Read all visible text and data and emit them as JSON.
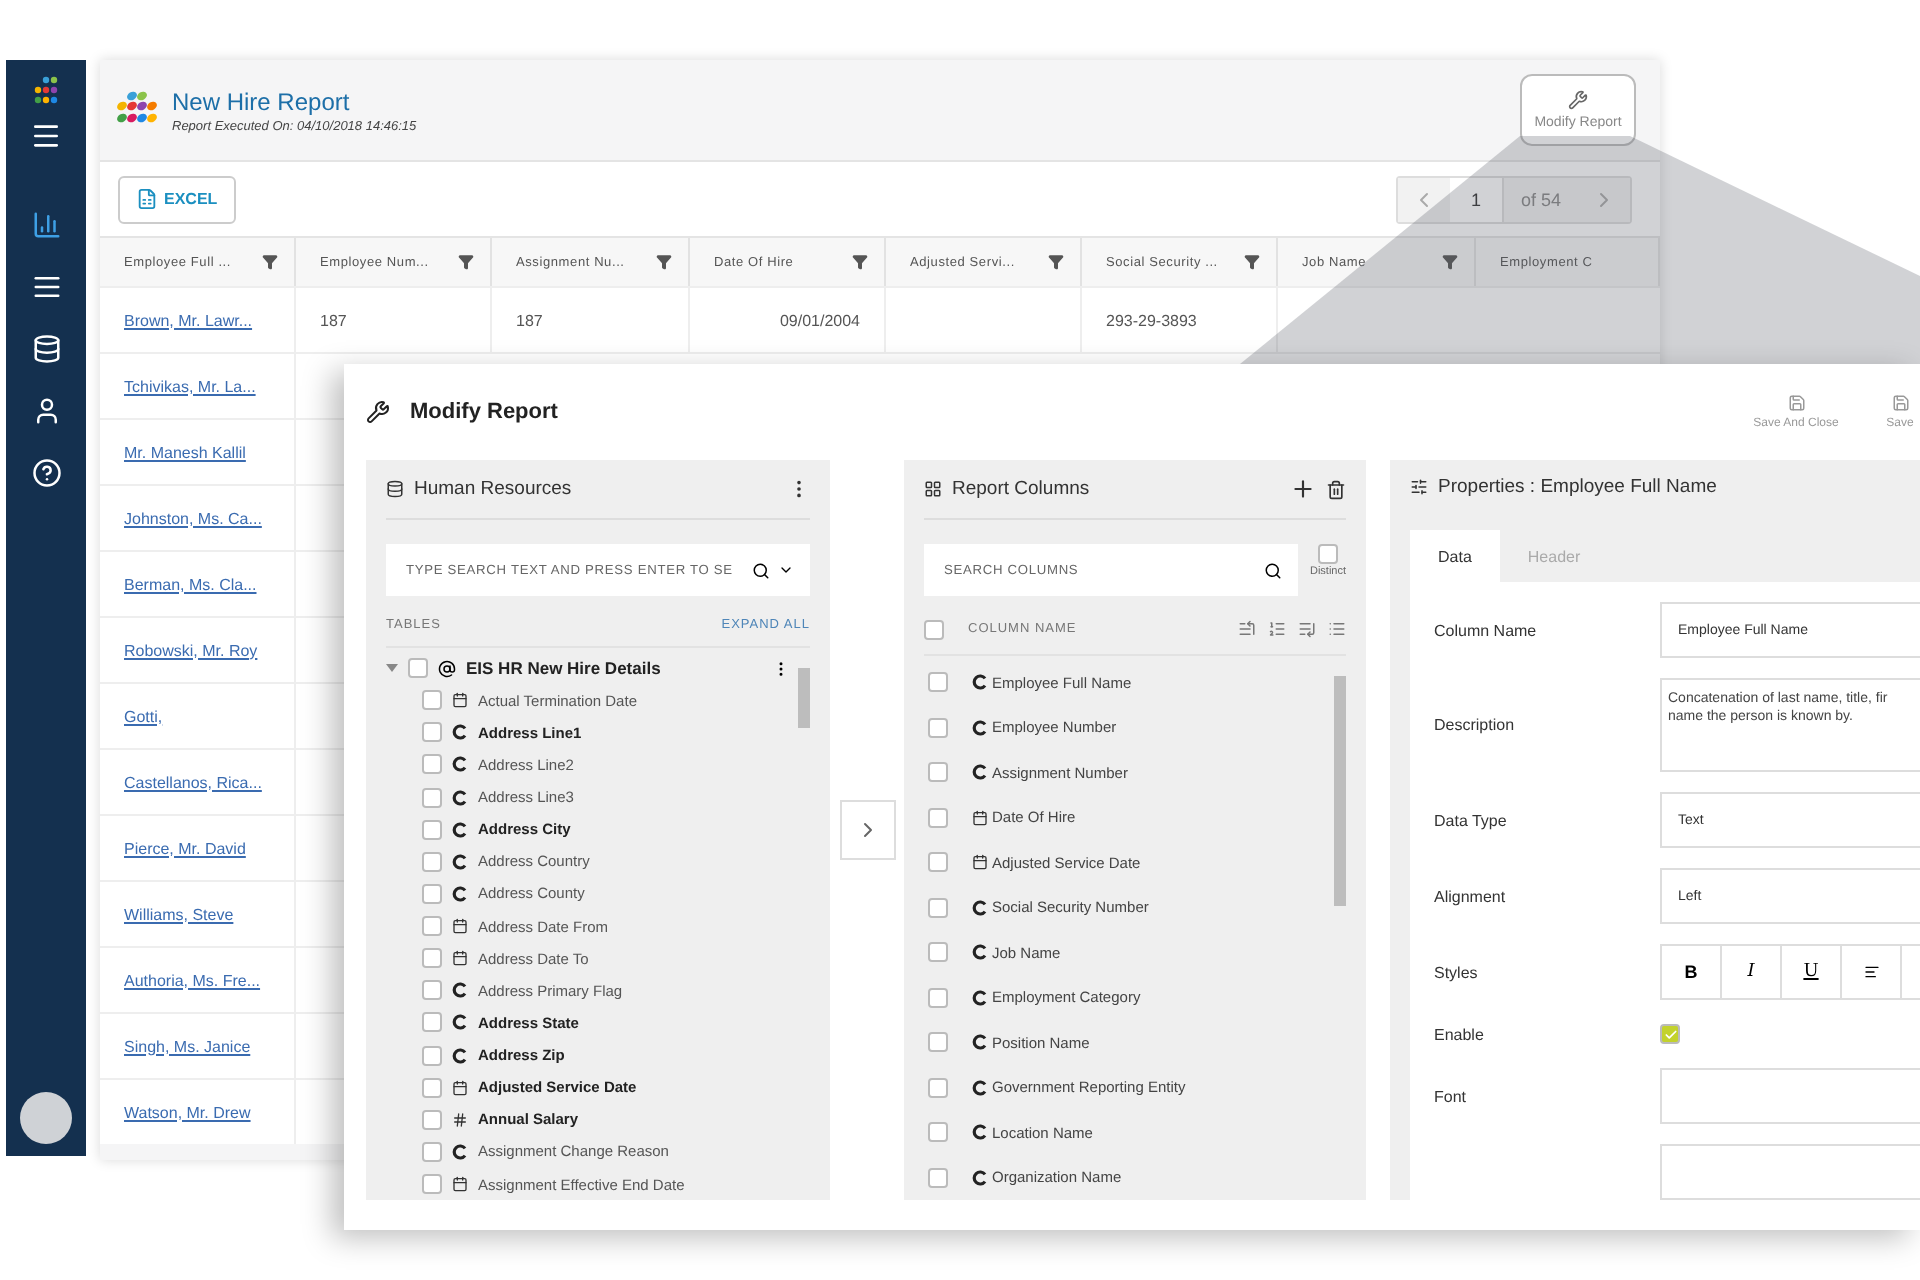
{
  "sidebar": {
    "items": [
      {
        "kind": "chart",
        "selected": true
      },
      {
        "kind": "list",
        "selected": false
      },
      {
        "kind": "database",
        "selected": false
      },
      {
        "kind": "user",
        "selected": false
      },
      {
        "kind": "help",
        "selected": false
      }
    ]
  },
  "report": {
    "title": "New Hire Report",
    "executed": "Report Executed On: 04/10/2018 14:46:15",
    "modify_button": "Modify Report",
    "excel_button": "EXCEL",
    "pager": {
      "page": "1",
      "total": "of 54"
    },
    "columns": [
      "Employee Full ...",
      "Employee Num...",
      "Assignment Nu...",
      "Date Of Hire",
      "Adjusted Servi...",
      "Social Security ...",
      "Job Name",
      "Employment C"
    ],
    "rows": [
      {
        "name": "Brown, Mr. Lawr...",
        "cells": [
          "187",
          "187",
          "09/01/2004",
          "",
          "293-29-3893"
        ]
      },
      {
        "name": "Tchivikas, Mr. La..."
      },
      {
        "name": "Mr. Manesh Kallil"
      },
      {
        "name": "Johnston, Ms. Ca..."
      },
      {
        "name": "Berman, Ms. Cla..."
      },
      {
        "name": "Robowski, Mr. Roy"
      },
      {
        "name": "Gotti,"
      },
      {
        "name": "Castellanos, Rica..."
      },
      {
        "name": "Pierce, Mr. David"
      },
      {
        "name": "Williams, Steve"
      },
      {
        "name": "Authoria, Ms. Fre..."
      },
      {
        "name": "Singh, Ms. Janice"
      },
      {
        "name": "Watson, Mr. Drew"
      }
    ]
  },
  "modal": {
    "title": "Modify Report",
    "actions": [
      "Save And Close",
      "Save"
    ],
    "source": {
      "title": "Human Resources",
      "search_placeholder": "TYPE SEARCH TEXT AND PRESS ENTER TO SE",
      "tables_label": "TABLES",
      "expand_all": "EXPAND ALL",
      "tree": {
        "label": "EIS HR New Hire Details",
        "expanded": true,
        "checked": false,
        "children": [
          {
            "label": "Actual Termination Date",
            "kind": "date",
            "bold": false,
            "checked": false
          },
          {
            "label": "Address Line1",
            "kind": "text",
            "bold": true,
            "checked": false
          },
          {
            "label": "Address Line2",
            "kind": "text",
            "bold": false,
            "checked": false
          },
          {
            "label": "Address Line3",
            "kind": "text",
            "bold": false,
            "checked": false
          },
          {
            "label": "Address City",
            "kind": "text",
            "bold": true,
            "checked": false
          },
          {
            "label": "Address Country",
            "kind": "text",
            "bold": false,
            "checked": false
          },
          {
            "label": "Address County",
            "kind": "text",
            "bold": false,
            "checked": false
          },
          {
            "label": "Address Date From",
            "kind": "date",
            "bold": false,
            "checked": false
          },
          {
            "label": "Address Date To",
            "kind": "date",
            "bold": false,
            "checked": false
          },
          {
            "label": "Address Primary Flag",
            "kind": "text",
            "bold": false,
            "checked": false
          },
          {
            "label": "Address State",
            "kind": "text",
            "bold": true,
            "checked": false
          },
          {
            "label": "Address Zip",
            "kind": "text",
            "bold": true,
            "checked": false
          },
          {
            "label": "Adjusted Service Date",
            "kind": "date",
            "bold": true,
            "checked": false
          },
          {
            "label": "Annual Salary",
            "kind": "number",
            "bold": true,
            "checked": false
          },
          {
            "label": "Assignment Change Reason",
            "kind": "text",
            "bold": false,
            "checked": false
          },
          {
            "label": "Assignment Effective End Date",
            "kind": "date",
            "bold": false,
            "checked": false
          }
        ]
      }
    },
    "columns": {
      "title": "Report Columns",
      "search_placeholder": "SEARCH COLUMNS",
      "distinct": {
        "label": "Distinct",
        "checked": false
      },
      "header": "COLUMN NAME",
      "all_checked": false,
      "items": [
        {
          "label": "Employee Full Name",
          "kind": "text",
          "checked": false
        },
        {
          "label": "Employee Number",
          "kind": "text",
          "checked": false
        },
        {
          "label": "Assignment Number",
          "kind": "text",
          "checked": false
        },
        {
          "label": "Date Of Hire",
          "kind": "date",
          "checked": false
        },
        {
          "label": "Adjusted Service Date",
          "kind": "date",
          "checked": false
        },
        {
          "label": "Social Security Number",
          "kind": "text",
          "checked": false
        },
        {
          "label": "Job Name",
          "kind": "text",
          "checked": false
        },
        {
          "label": "Employment Category",
          "kind": "text",
          "checked": false
        },
        {
          "label": "Position Name",
          "kind": "text",
          "checked": false
        },
        {
          "label": "Government Reporting Entity",
          "kind": "text",
          "checked": false
        },
        {
          "label": "Location Name",
          "kind": "text",
          "checked": false
        },
        {
          "label": "Organization Name",
          "kind": "text",
          "checked": false
        }
      ]
    },
    "properties": {
      "title": "Properties : Employee Full Name",
      "tabs": [
        {
          "label": "Data",
          "selected": true
        },
        {
          "label": "Header",
          "selected": false
        }
      ],
      "fields": [
        {
          "kind": "input",
          "label": "Column Name",
          "value": "Employee Full Name"
        },
        {
          "kind": "textarea",
          "label": "Description",
          "lines": [
            "Concatenation of last name, title, fir",
            "name the person is known by."
          ]
        },
        {
          "kind": "input",
          "label": "Data Type",
          "value": "Text"
        },
        {
          "kind": "input",
          "label": "Alignment",
          "value": "Left"
        },
        {
          "kind": "styles",
          "label": "Styles",
          "buttons": [
            "B",
            "I",
            "U"
          ]
        },
        {
          "kind": "checkbox",
          "label": "Enable",
          "checked": true
        },
        {
          "kind": "input",
          "label": "Font"
        },
        {
          "kind": "input"
        }
      ]
    }
  }
}
